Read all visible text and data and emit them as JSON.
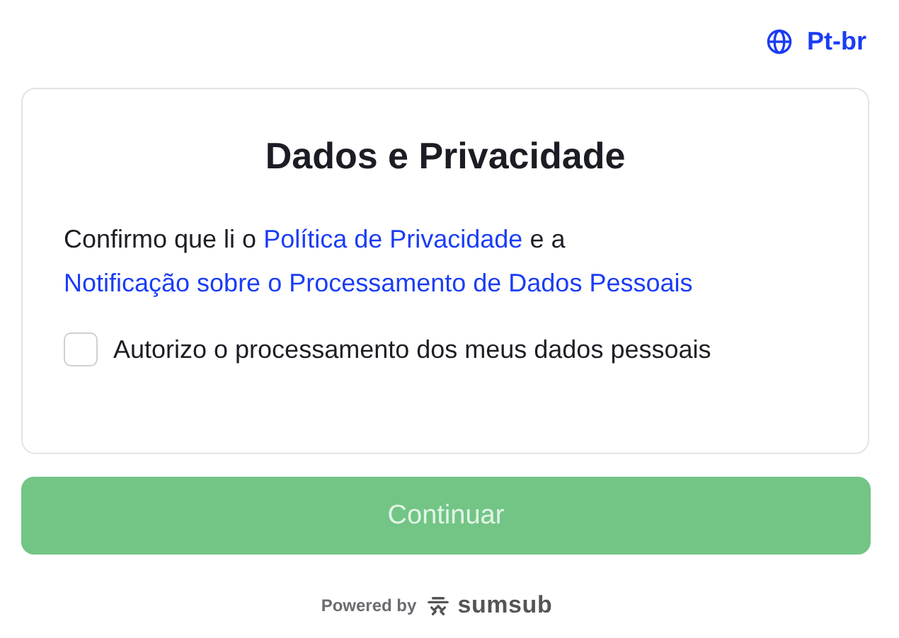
{
  "language": {
    "label": "Pt-br"
  },
  "card": {
    "title": "Dados e Privacidade",
    "consent_text": [
      {
        "kind": "text",
        "text": "Confirmo que li o "
      },
      {
        "kind": "link",
        "text": "Política de Privacidade"
      },
      {
        "kind": "text",
        "text": " e a "
      },
      {
        "kind": "link",
        "text": "Notificação sobre o Processamento de Dados Pessoais"
      }
    ],
    "checkbox": {
      "label": "Autorizo o processamento dos meus dados pessoais",
      "checked": false
    }
  },
  "continue_button": {
    "label": "Continuar",
    "disabled": true
  },
  "footer": {
    "powered_by": "Powered by",
    "brand": "sumsub"
  }
}
